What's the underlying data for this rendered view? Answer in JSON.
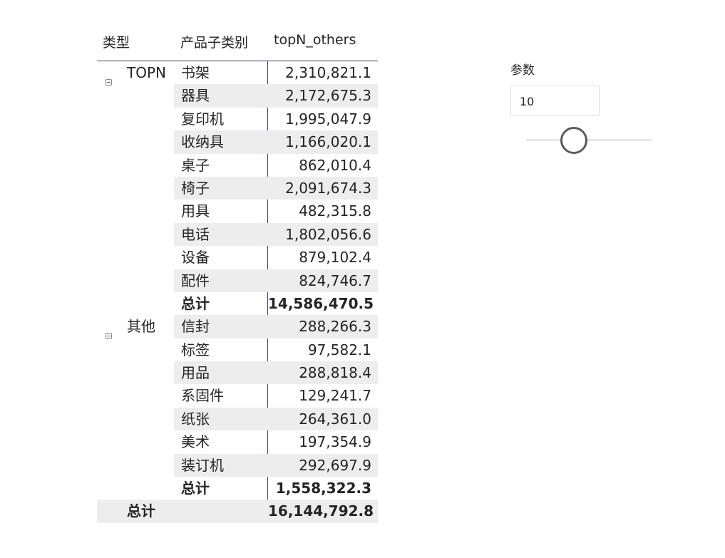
{
  "matrix": {
    "headers": {
      "type": "类型",
      "subcategory": "产品子类别",
      "measure": "topN_others"
    },
    "groups": [
      {
        "label": "TOPN",
        "rows": [
          {
            "sub": "书架",
            "value": "2,310,821.1"
          },
          {
            "sub": "器具",
            "value": "2,172,675.3"
          },
          {
            "sub": "复印机",
            "value": "1,995,047.9"
          },
          {
            "sub": "收纳具",
            "value": "1,166,020.1"
          },
          {
            "sub": "桌子",
            "value": "862,010.4"
          },
          {
            "sub": "椅子",
            "value": "2,091,674.3"
          },
          {
            "sub": "用具",
            "value": "482,315.8"
          },
          {
            "sub": "电话",
            "value": "1,802,056.6"
          },
          {
            "sub": "设备",
            "value": "879,102.4"
          },
          {
            "sub": "配件",
            "value": "824,746.7"
          }
        ],
        "subtotal_label": "总计",
        "subtotal_value": "14,586,470.5"
      },
      {
        "label": "其他",
        "rows": [
          {
            "sub": "信封",
            "value": "288,266.3"
          },
          {
            "sub": "标签",
            "value": "97,582.1"
          },
          {
            "sub": "用品",
            "value": "288,818.4"
          },
          {
            "sub": "系固件",
            "value": "129,241.7"
          },
          {
            "sub": "纸张",
            "value": "264,361.0"
          },
          {
            "sub": "美术",
            "value": "197,354.9"
          },
          {
            "sub": "装订机",
            "value": "292,697.9"
          }
        ],
        "subtotal_label": "总计",
        "subtotal_value": "1,558,322.3"
      }
    ],
    "grand_total_label": "总计",
    "grand_total_value": "16,144,792.8"
  },
  "slicer": {
    "title": "参数",
    "value": "10",
    "slider_level_fraction": 0.38
  },
  "colors": {
    "header_rule": "#3b3a8a",
    "row_shade": "#ededed",
    "thumb_border": "#5a5a5a"
  }
}
